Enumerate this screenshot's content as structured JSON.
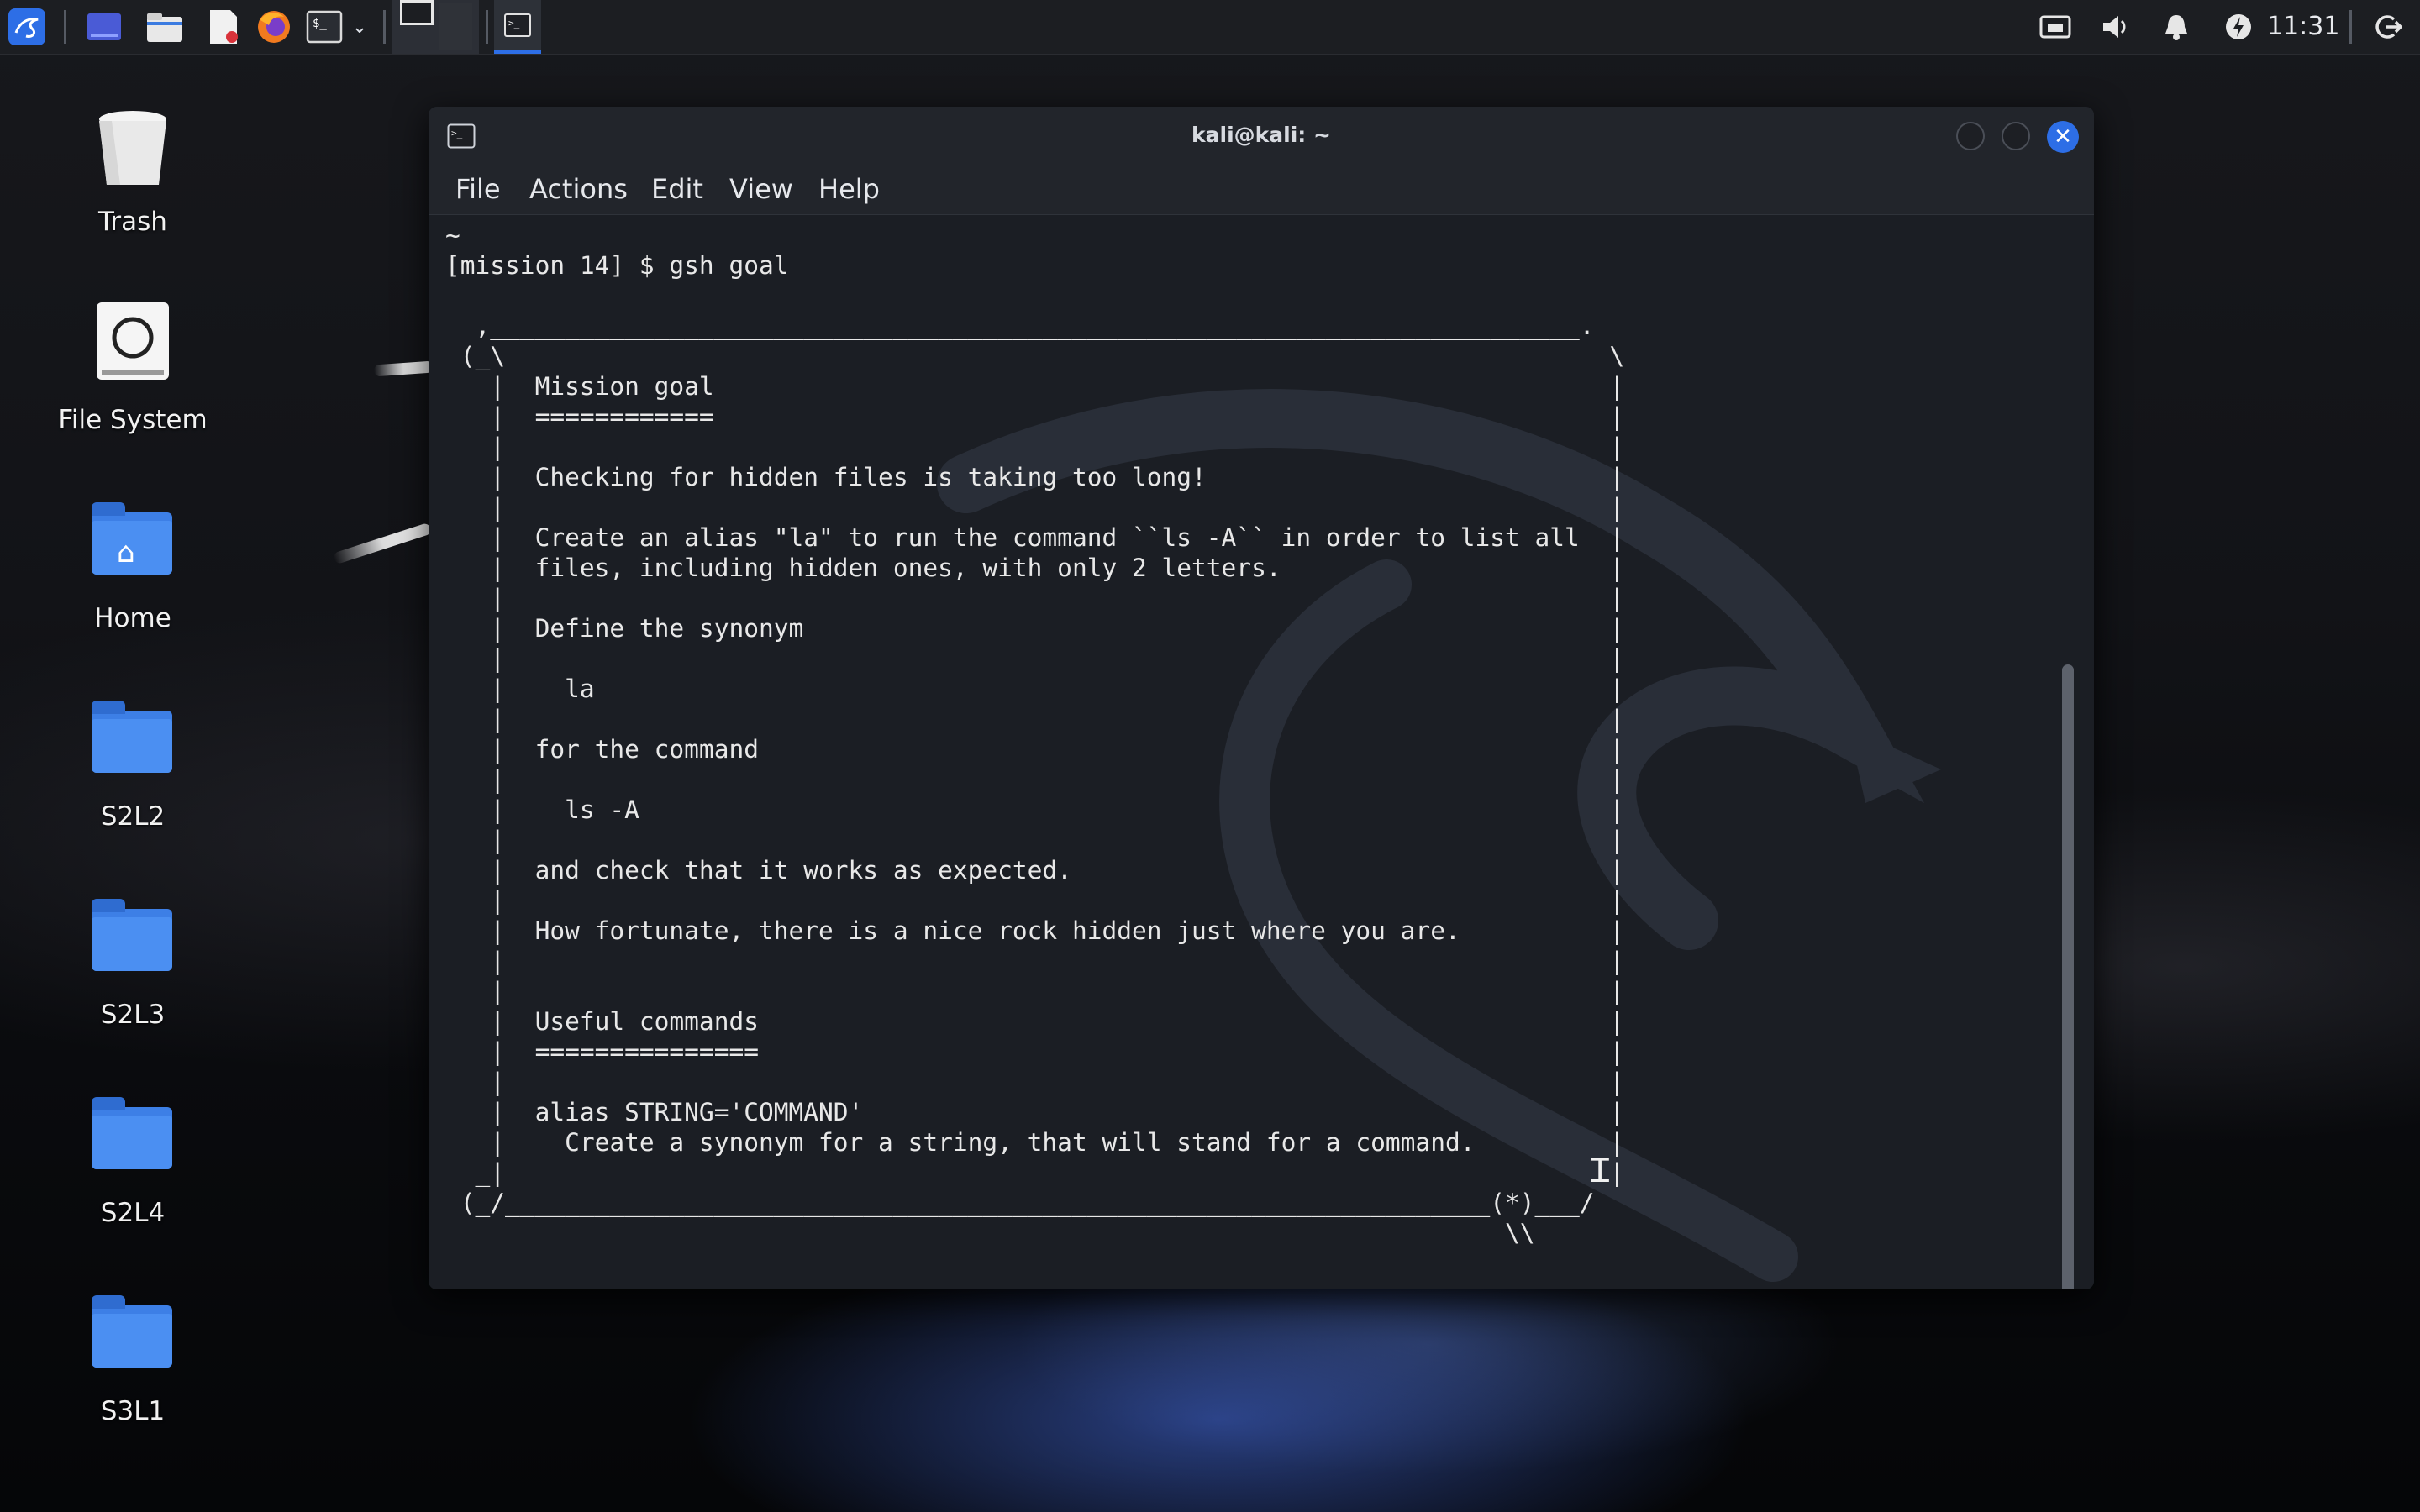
{
  "taskbar": {
    "icons": [
      "kali-menu-icon",
      "workspace-icon",
      "file-manager-icon",
      "text-editor-icon",
      "firefox-icon",
      "terminal-icon",
      "chevron-down-icon",
      "workspace-1-icon",
      "workspace-2-icon",
      "active-terminal-icon"
    ],
    "tray_icons": [
      "network-icon",
      "volume-icon",
      "notifications-icon",
      "power-manager-icon",
      "logout-icon"
    ],
    "clock": "11:31"
  },
  "desktop": {
    "items": [
      {
        "label": "Trash",
        "icon": "trash-icon"
      },
      {
        "label": "File System",
        "icon": "drive-icon"
      },
      {
        "label": "Home",
        "icon": "home-folder-icon"
      },
      {
        "label": "S2L2",
        "icon": "folder-icon"
      },
      {
        "label": "S2L3",
        "icon": "folder-icon"
      },
      {
        "label": "S2L4",
        "icon": "folder-icon"
      },
      {
        "label": "S3L1",
        "icon": "folder-icon"
      }
    ]
  },
  "terminal": {
    "title": "kali@kali: ~",
    "menu": [
      "File",
      "Actions",
      "Edit",
      "View",
      "Help"
    ],
    "content": "~\n[mission 14] $ gsh goal\n\n  ,_________________________________________________________________________.\n (_\\                                                                          \\\n   |  Mission goal                                                            |\n   |  ============                                                            |\n   |                                                                          |\n   |  Checking for hidden files is taking too long!                           |\n   |                                                                          |\n   |  Create an alias \"la\" to run the command ``ls -A`` in order to list all  |\n   |  files, including hidden ones, with only 2 letters.                      |\n   |                                                                          |\n   |  Define the synonym                                                      |\n   |                                                                          |\n   |    la                                                                    |\n   |                                                                          |\n   |  for the command                                                         |\n   |                                                                          |\n   |    ls -A                                                                 |\n   |                                                                          |\n   |  and check that it works as expected.                                    |\n   |                                                                          |\n   |  How fortunate, there is a nice rock hidden just where you are.          |\n   |                                                                          |\n   |                                                                          |\n   |  Useful commands                                                         |\n   |  ===============                                                         |\n   |                                                                          |\n   |  alias STRING='COMMAND'                                                  |\n   |    Create a synonym for a string, that will stand for a command.         |\n  _|                                                                          |\n (_/__________________________________________________________________(*)___/\n                                                                       \\\\"
  },
  "colors": {
    "accent": "#2d6ee6",
    "terminal_bg": "#1b1e24",
    "terminal_fg": "#e8e8e8",
    "folder": "#4b8ff2"
  }
}
